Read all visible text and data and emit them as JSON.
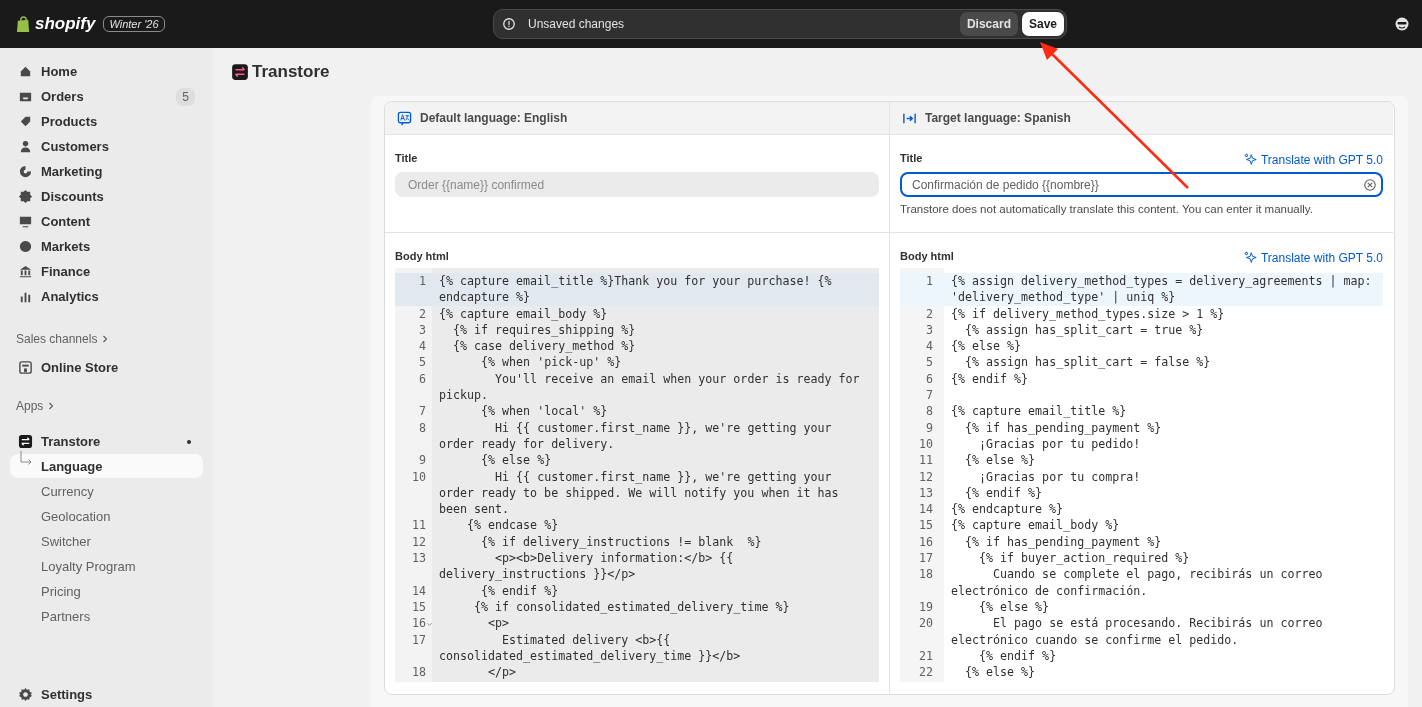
{
  "topbar": {
    "logo": "shopify",
    "edition": "Winter '26",
    "notice": "Unsaved changes",
    "buttons": [
      {
        "label": "Discard",
        "kind": "secondary"
      },
      {
        "label": "Save",
        "kind": "primary"
      }
    ]
  },
  "sidebar": {
    "items": [
      {
        "label": "Home",
        "selected": false
      },
      {
        "label": "Orders",
        "selected": false,
        "badge": "5"
      },
      {
        "label": "Products",
        "selected": false
      },
      {
        "label": "Customers",
        "selected": false
      },
      {
        "label": "Marketing",
        "selected": false
      },
      {
        "label": "Discounts",
        "selected": false
      },
      {
        "label": "Content",
        "selected": false
      },
      {
        "label": "Markets",
        "selected": false
      },
      {
        "label": "Finance",
        "selected": false
      },
      {
        "label": "Analytics",
        "selected": false
      }
    ],
    "sales_channels": {
      "heading": "Sales channels",
      "items": [
        {
          "label": "Online Store",
          "selected": false
        }
      ]
    },
    "apps": {
      "heading": "Apps",
      "items": [
        {
          "label": "Transtore",
          "selected": false,
          "dot": true,
          "children": [
            {
              "label": "Language",
              "selected": true
            },
            {
              "label": "Currency",
              "selected": false
            },
            {
              "label": "Geolocation",
              "selected": false
            },
            {
              "label": "Switcher",
              "selected": false
            },
            {
              "label": "Loyalty Program",
              "selected": false
            },
            {
              "label": "Pricing",
              "selected": false
            },
            {
              "label": "Partners",
              "selected": false
            }
          ]
        }
      ]
    },
    "settings": {
      "label": "Settings",
      "selected": false
    }
  },
  "page": {
    "title": "Transtore"
  },
  "columns": [
    {
      "header": "Default language: English",
      "title_label": "Title",
      "title_value": "Order {{name}} confirmed",
      "disabled": true,
      "focused": false,
      "body_label": "Body html",
      "lines": [
        {
          "n": "1",
          "text": "{% capture email_title %}Thank you for your purchase! {% endcapture %}",
          "active": true,
          "foldable": false
        },
        {
          "n": "2",
          "text": "{% capture email_body %}",
          "active": false,
          "foldable": false
        },
        {
          "n": "3",
          "text": "  {% if requires_shipping %}",
          "active": false,
          "foldable": false
        },
        {
          "n": "4",
          "text": "  {% case delivery_method %}",
          "active": false,
          "foldable": false
        },
        {
          "n": "5",
          "text": "      {% when 'pick-up' %}",
          "active": false,
          "foldable": false
        },
        {
          "n": "6",
          "text": "        You'll receive an email when your order is ready for pickup.",
          "active": false,
          "foldable": false
        },
        {
          "n": "7",
          "text": "      {% when 'local' %}",
          "active": false,
          "foldable": false
        },
        {
          "n": "8",
          "text": "        Hi {{ customer.first_name }}, we're getting your order ready for delivery.",
          "active": false,
          "foldable": false
        },
        {
          "n": "9",
          "text": "      {% else %}",
          "active": false,
          "foldable": false
        },
        {
          "n": "10",
          "text": "        Hi {{ customer.first_name }}, we're getting your order ready to be shipped. We will notify you when it has been sent.",
          "active": false,
          "foldable": false
        },
        {
          "n": "11",
          "text": "    {% endcase %}",
          "active": false,
          "foldable": false
        },
        {
          "n": "12",
          "text": "      {% if delivery_instructions != blank  %}",
          "active": false,
          "foldable": false
        },
        {
          "n": "13",
          "text": "        <p><b>Delivery information:</b> {{ delivery_instructions }}</p>",
          "active": false,
          "foldable": false
        },
        {
          "n": "14",
          "text": "      {% endif %}",
          "active": false,
          "foldable": false
        },
        {
          "n": "15",
          "text": "     {% if consolidated_estimated_delivery_time %}",
          "active": false,
          "foldable": false
        },
        {
          "n": "16",
          "text": "       <p>",
          "active": false,
          "foldable": true
        },
        {
          "n": "17",
          "text": "         Estimated delivery <b>{{ consolidated_estimated_delivery_time }}</b>",
          "active": false,
          "foldable": false
        },
        {
          "n": "18",
          "text": "       </p>",
          "active": false,
          "foldable": false
        }
      ]
    },
    {
      "header": "Target language: Spanish",
      "title_label": "Title",
      "translate_link": "Translate with GPT 5.0",
      "title_value": "Confirmación de pedido {{nombre}}",
      "disabled": false,
      "focused": true,
      "help": "Transtore does not automatically translate this content. You can enter it manually.",
      "body_label": "Body html",
      "body_translate_link": "Translate with GPT 5.0",
      "lines": [
        {
          "n": "1",
          "text": "{% assign delivery_method_types = delivery_agreements | map: 'delivery_method_type' | uniq %}",
          "active": true,
          "foldable": false
        },
        {
          "n": "2",
          "text": "{% if delivery_method_types.size > 1 %}",
          "active": false,
          "foldable": false
        },
        {
          "n": "3",
          "text": "  {% assign has_split_cart = true %}",
          "active": false,
          "foldable": false
        },
        {
          "n": "4",
          "text": "{% else %}",
          "active": false,
          "foldable": false
        },
        {
          "n": "5",
          "text": "  {% assign has_split_cart = false %}",
          "active": false,
          "foldable": false
        },
        {
          "n": "6",
          "text": "{% endif %}",
          "active": false,
          "foldable": false
        },
        {
          "n": "7",
          "active": false,
          "foldable": false
        },
        {
          "n": "8",
          "text": "{% capture email_title %}",
          "active": false,
          "foldable": false
        },
        {
          "n": "9",
          "text": "  {% if has_pending_payment %}",
          "active": false,
          "foldable": false
        },
        {
          "n": "10",
          "text": "    ¡Gracias por tu pedido!",
          "active": false,
          "foldable": false
        },
        {
          "n": "11",
          "text": "  {% else %}",
          "active": false,
          "foldable": false
        },
        {
          "n": "12",
          "text": "    ¡Gracias por tu compra!",
          "active": false,
          "foldable": false
        },
        {
          "n": "13",
          "text": "  {% endif %}",
          "active": false,
          "foldable": false
        },
        {
          "n": "14",
          "text": "{% endcapture %}",
          "active": false,
          "foldable": false
        },
        {
          "n": "15",
          "text": "{% capture email_body %}",
          "active": false,
          "foldable": false
        },
        {
          "n": "16",
          "text": "  {% if has_pending_payment %}",
          "active": false,
          "foldable": false
        },
        {
          "n": "17",
          "text": "    {% if buyer_action_required %}",
          "active": false,
          "foldable": false
        },
        {
          "n": "18",
          "text": "      Cuando se complete el pago, recibirás un correo electrónico de confirmación.",
          "active": false,
          "foldable": false
        },
        {
          "n": "19",
          "text": "    {% else %}",
          "active": false,
          "foldable": false
        },
        {
          "n": "20",
          "text": "      El pago se está procesando. Recibirás un correo electrónico cuando se confirme el pedido.",
          "active": false,
          "foldable": false
        },
        {
          "n": "21",
          "text": "    {% endif %}",
          "active": false,
          "foldable": false
        },
        {
          "n": "22",
          "text": "  {% else %}",
          "active": false,
          "foldable": false
        }
      ]
    }
  ]
}
